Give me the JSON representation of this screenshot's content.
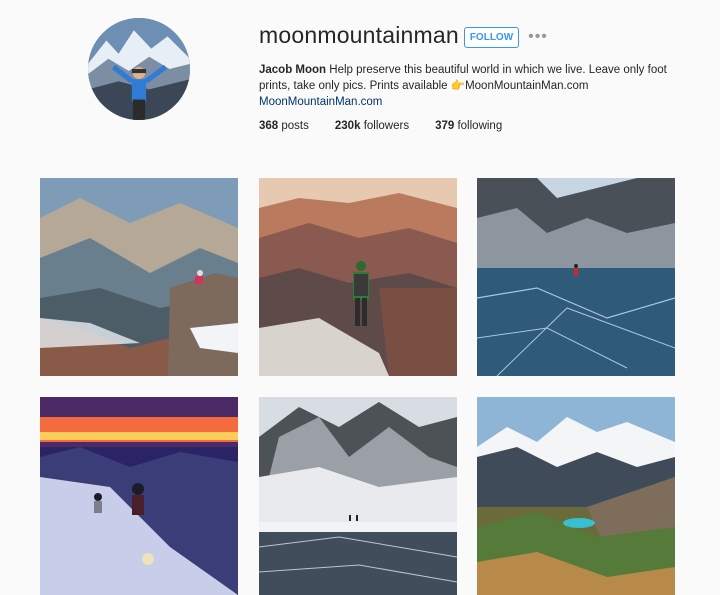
{
  "profile": {
    "username": "moonmountainman",
    "follow_label": "FOLLOW",
    "more_label": "•••",
    "name": "Jacob Moon",
    "bio_text": "Help preserve this beautiful world in which we live. Leave only foot prints, take only pics. Prints available 👉MoonMountainMan.com",
    "website": "MoonMountainMan.com"
  },
  "stats": {
    "posts_count": "368",
    "posts_label": "posts",
    "followers_count": "230k",
    "followers_label": "followers",
    "following_count": "379",
    "following_label": "following"
  },
  "posts": [
    {
      "subject": "canyon-sitter"
    },
    {
      "subject": "canyon-hiker"
    },
    {
      "subject": "frozen-lake-red"
    },
    {
      "subject": "sunset-snow-climbers"
    },
    {
      "subject": "ice-lake-mountains"
    },
    {
      "subject": "turquoise-lake-peaks"
    }
  ],
  "colors": {
    "accent": "#3897f0",
    "link": "#003569",
    "text": "#262626"
  }
}
